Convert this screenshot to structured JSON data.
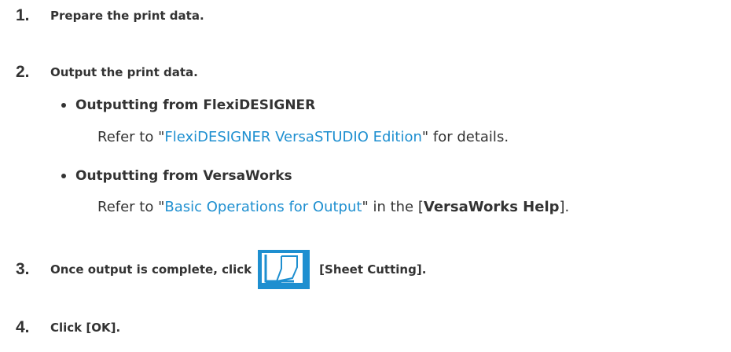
{
  "steps": [
    {
      "number": "1.",
      "text": "Prepare the print data."
    },
    {
      "number": "2.",
      "text": "Output the print data."
    },
    {
      "number": "3.",
      "text_before": "Once output is complete, click",
      "text_after": "[Sheet Cutting]."
    },
    {
      "number": "4.",
      "text": "Click [OK]."
    }
  ],
  "bullets": [
    {
      "title": "Outputting from FlexiDESIGNER",
      "ref_prefix": "Refer to \"",
      "ref_link": "FlexiDESIGNER VersaSTUDIO Edition",
      "ref_suffix": "\" for details."
    },
    {
      "title": "Outputting from VersaWorks",
      "ref_prefix": "Refer to \"",
      "ref_link": "Basic Operations for Output",
      "ref_middle": "\" in the [",
      "ref_bold": "VersaWorks Help",
      "ref_suffix": "]."
    }
  ],
  "icons": {
    "sheet_cutting": "sheet-cutting-icon"
  },
  "colors": {
    "text": "#333333",
    "link": "#1e8fd0",
    "icon_bg": "#1e8fd0"
  }
}
